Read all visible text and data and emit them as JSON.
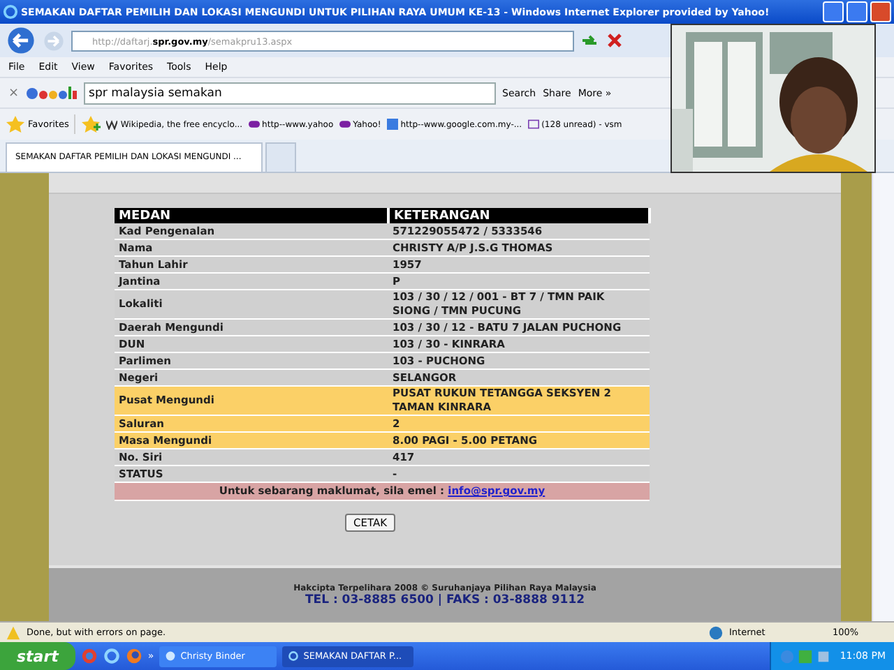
{
  "window": {
    "title": "SEMAKAN DAFTAR PEMILIH DAN LOKASI MENGUNDI UNTUK PILIHAN RAYA UMUM KE-13 - Windows Internet Explorer provided by Yahoo!"
  },
  "address_bar": {
    "value_prefix": "http://daftarj.",
    "value_domain": "spr.gov.my",
    "value_suffix": "/semakpru13.aspx"
  },
  "menu": [
    "File",
    "Edit",
    "View",
    "Favorites",
    "Tools",
    "Help"
  ],
  "google_toolbar": {
    "close": "×",
    "query": "spr malaysia semakan",
    "buttons": [
      "Search",
      "Share",
      "More »"
    ]
  },
  "favorites_bar": {
    "label": "Favorites",
    "links": [
      {
        "kind": "wiki",
        "label": "Wikipedia, the free encyclo..."
      },
      {
        "kind": "yahoo",
        "label": "http--www.yahoo"
      },
      {
        "kind": "yahoo",
        "label": "Yahoo!"
      },
      {
        "kind": "google",
        "label": "http--www.google.com.my-..."
      },
      {
        "kind": "mail",
        "label": "(128 unread) - vsm"
      }
    ]
  },
  "tabs": [
    {
      "label": "SEMAKAN DAFTAR PEMILIH DAN LOKASI MENGUNDI ...",
      "selected": true
    },
    {
      "selected": false
    }
  ],
  "table": {
    "columns": [
      "MEDAN",
      "KETERANGAN"
    ],
    "rows": [
      {
        "field": "Kad Pengenalan",
        "value": "571229055472 / 5333546",
        "highlighted": false
      },
      {
        "field": "Nama",
        "value": "CHRISTY A/P J.S.G THOMAS",
        "highlighted": false
      },
      {
        "field": "Tahun Lahir",
        "value": "1957",
        "highlighted": false
      },
      {
        "field": "Jantina",
        "value": "P",
        "highlighted": false
      },
      {
        "field": "Lokaliti",
        "value": "103 / 30 / 12 / 001 - BT 7 / TMN PAIK SIONG / TMN PUCUNG",
        "highlighted": false
      },
      {
        "field": "Daerah Mengundi",
        "value": "103 / 30 / 12 - BATU 7 JALAN PUCHONG",
        "highlighted": false
      },
      {
        "field": "DUN",
        "value": "103 / 30 - KINRARA",
        "highlighted": false
      },
      {
        "field": "Parlimen",
        "value": "103 - PUCHONG",
        "highlighted": false
      },
      {
        "field": "Negeri",
        "value": "SELANGOR",
        "highlighted": false
      },
      {
        "field": "Pusat Mengundi",
        "value": "PUSAT RUKUN TETANGGA SEKSYEN 2 TAMAN KINRARA",
        "highlighted": true
      },
      {
        "field": "Saluran",
        "value": "2",
        "highlighted": true
      },
      {
        "field": "Masa Mengundi",
        "value": "8.00 PAGI - 5.00 PETANG",
        "highlighted": true
      },
      {
        "field": "No. Siri",
        "value": "417",
        "highlighted": false
      },
      {
        "field": "STATUS",
        "value": "-",
        "highlighted": false
      }
    ],
    "footer_text": "Untuk sebarang maklumat, sila emel :",
    "footer_link": "info@spr.gov.my"
  },
  "print_button": "CETAK",
  "page_footer": {
    "copyright": "Hakcipta Terpelihara 2008 © Suruhanjaya Pilihan Raya Malaysia",
    "contact": "TEL : 03-8885 6500 | FAKS : 03-8888 9112"
  },
  "status_bar": {
    "message": "Done, but with errors on page.",
    "zone": "Internet",
    "zoom": "100%"
  },
  "taskbar": {
    "start": "start",
    "overflow": "»",
    "windows": [
      {
        "kind": "chat",
        "label": "Christy Binder",
        "selected": false
      },
      {
        "kind": "ie",
        "label": "SEMAKAN DAFTAR P...",
        "selected": true
      }
    ],
    "clock": "11:08 PM"
  }
}
